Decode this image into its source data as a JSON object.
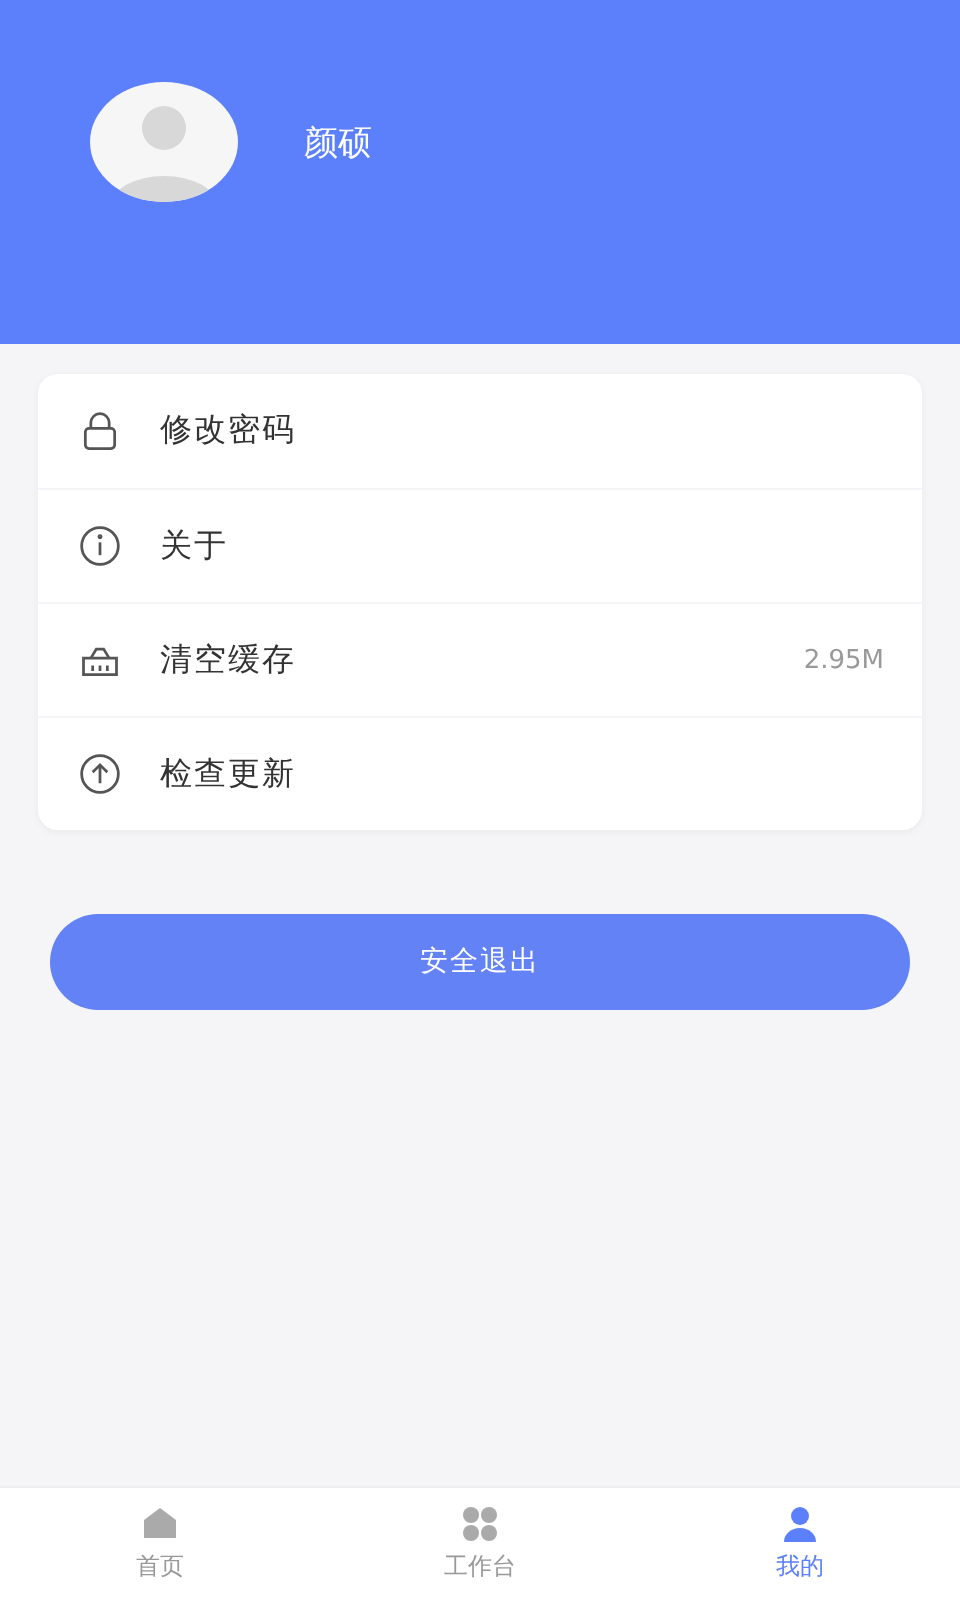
{
  "profile": {
    "name": "颜硕"
  },
  "menu": [
    {
      "kind": "lock",
      "label": "修改密码"
    },
    {
      "kind": "info",
      "label": "关于"
    },
    {
      "kind": "basket",
      "label": "清空缓存",
      "value": "2.95M"
    },
    {
      "kind": "upload",
      "label": "检查更新"
    }
  ],
  "logout_button": "安全退出",
  "tabs": [
    {
      "kind": "home",
      "label": "首页",
      "selected": false
    },
    {
      "kind": "grid",
      "label": "工作台",
      "selected": false
    },
    {
      "kind": "person",
      "label": "我的",
      "selected": true
    }
  ]
}
